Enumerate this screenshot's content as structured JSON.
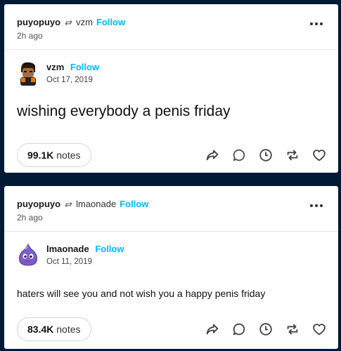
{
  "posts": [
    {
      "reblogger": "puyopuyo",
      "reblog_icon": "reblog-icon",
      "source": "vzm",
      "follow_label": "Follow",
      "time_ago": "2h ago",
      "author": "vzm",
      "author_follow_label": "Follow",
      "date": "Oct 17, 2019",
      "text": "wishing everybody a penis friday",
      "notes_count": "99.1K",
      "notes_label": "notes"
    },
    {
      "reblogger": "puyopuyo",
      "reblog_icon": "reblog-icon",
      "source": "lmaonade",
      "follow_label": "Follow",
      "time_ago": "2h ago",
      "author": "lmaonade",
      "author_follow_label": "Follow",
      "date": "Oct 11, 2019",
      "text": "haters will see you and not wish you a happy penis friday",
      "notes_count": "83.4K",
      "notes_label": "notes"
    }
  ],
  "colors": {
    "background": "#001935",
    "follow": "#00b8ff",
    "card": "#ffffff"
  },
  "icons": [
    "reblog-icon",
    "more-icon",
    "share-icon",
    "reply-icon",
    "clock-icon",
    "reblog-action-icon",
    "heart-icon"
  ]
}
